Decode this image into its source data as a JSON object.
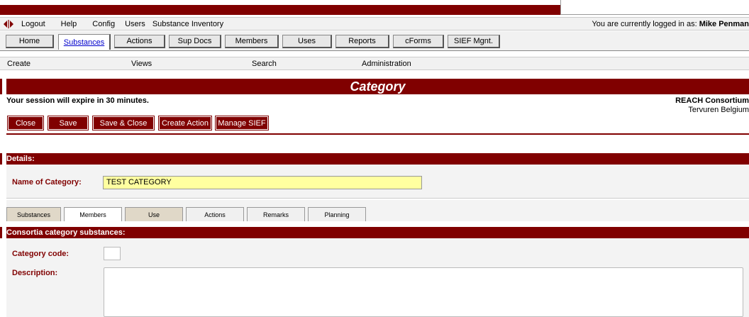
{
  "menu": {
    "items": [
      "Logout",
      "Help",
      "Config",
      "Users",
      "Substance Inventory"
    ],
    "login_prefix": "You are currently logged in as: ",
    "login_user": "Mike Penman"
  },
  "tabs": [
    "Home",
    "Substances",
    "Actions",
    "Sup Docs",
    "Members",
    "Uses",
    "Reports",
    "cForms",
    "SIEF Mgnt."
  ],
  "active_tab": "Substances",
  "submenu": [
    "Create",
    "Views",
    "Search",
    "Administration"
  ],
  "page": {
    "title": "Category",
    "session_notice": "Your session will expire in 30 minutes.",
    "org_name": "REACH Consortium",
    "org_location": "Tervuren Belgium"
  },
  "actions": [
    "Close",
    "Save",
    "Save & Close",
    "Create Action",
    "Manage SIEF"
  ],
  "details": {
    "header": "Details:",
    "name_label": "Name of Category:",
    "name_value": "TEST CATEGORY"
  },
  "lower_tabs": [
    "Substances",
    "Members",
    "Use",
    "Actions",
    "Remarks",
    "Planning"
  ],
  "section": {
    "header": "Consortia category substances:",
    "code_label": "Category code:",
    "code_value": "",
    "description_label": "Description:",
    "description_value": ""
  },
  "colors": {
    "accent": "#800000",
    "input_highlight": "#ffffa0"
  }
}
